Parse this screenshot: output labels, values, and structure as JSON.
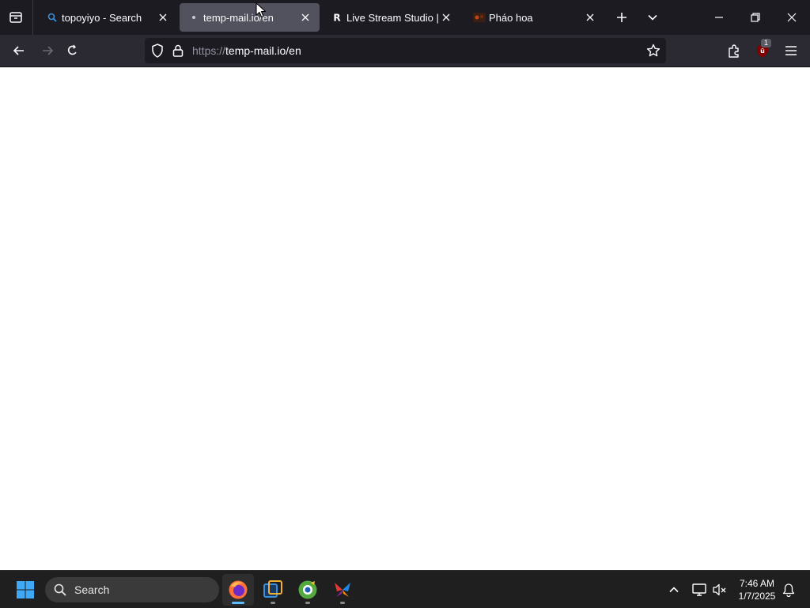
{
  "browser": {
    "tabs": [
      {
        "label": "topoyiyo - Search",
        "active": false
      },
      {
        "label": "temp-mail.io/en",
        "active": true
      },
      {
        "label": "Live Stream Studio | Re",
        "active": false
      },
      {
        "label": "Pháo hoa",
        "active": false
      }
    ],
    "url": {
      "protocol": "https://",
      "host": "temp-mail.io/en"
    },
    "extension_badge": "1"
  },
  "taskbar": {
    "search_label": "Search",
    "clock": {
      "time": "7:46 AM",
      "date": "1/7/2025"
    },
    "apps": [
      "firefox-app",
      "virtualbox-app",
      "browser-app",
      "app"
    ]
  },
  "colors": {
    "tab_active": "#52525e",
    "accent": "#00ddff",
    "badge": "#d70022"
  }
}
